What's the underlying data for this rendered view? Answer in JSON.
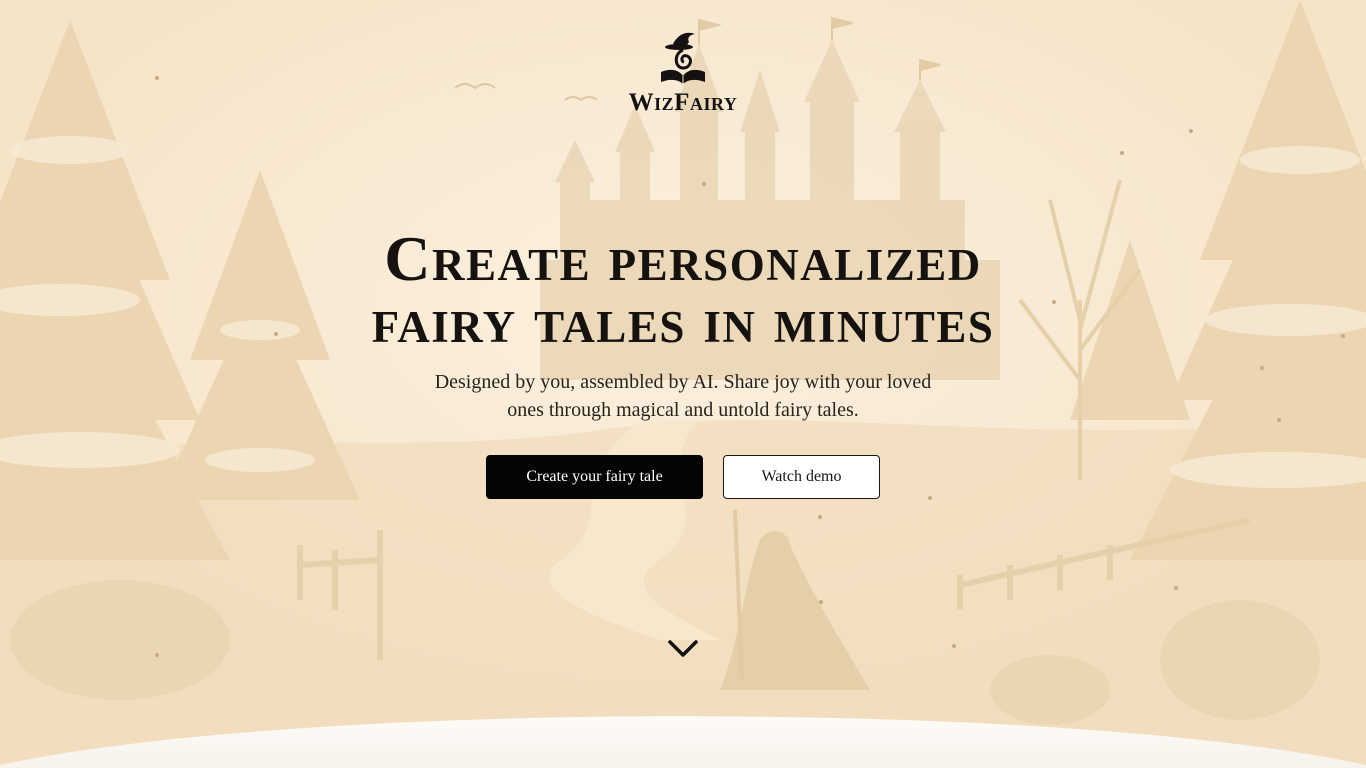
{
  "brand": {
    "name": "WizFairy",
    "logo_icon": "wizard-hat-book-icon"
  },
  "hero": {
    "headline_line1": "Create personalized",
    "headline_line2": "fairy tales in minutes",
    "subtitle_line1": "Designed by you, assembled by AI. Share joy with your loved",
    "subtitle_line2": "ones through magical and untold fairy tales."
  },
  "actions": {
    "primary_label": "Create your fairy tale",
    "secondary_label": "Watch demo"
  },
  "scroll": {
    "icon": "chevron-down-icon"
  },
  "colors": {
    "background": "#f8e9d2",
    "primary_button": "#050505",
    "text": "#16120f"
  }
}
